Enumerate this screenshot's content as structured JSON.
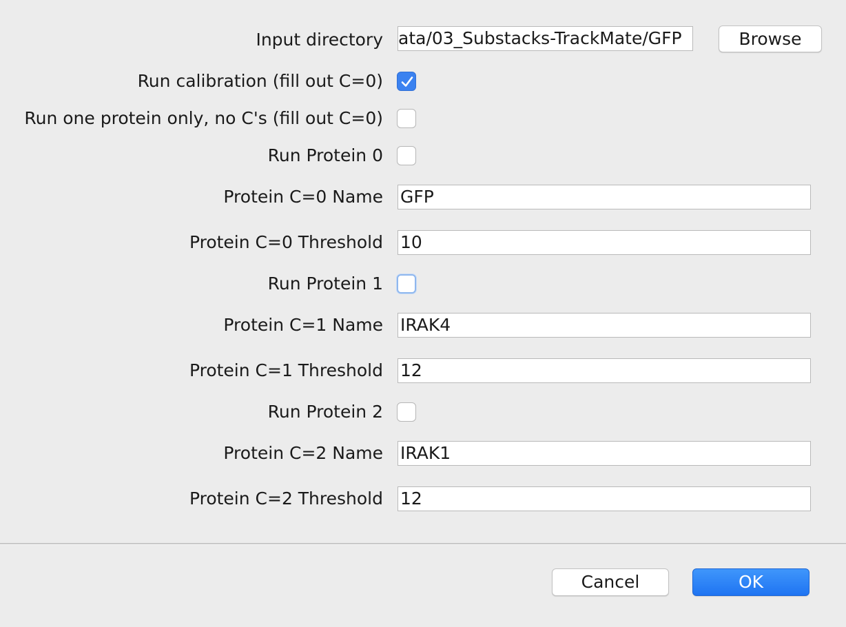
{
  "form": {
    "input_directory": {
      "label": "Input directory",
      "value": "ata/03_Substacks-TrackMate/GFP",
      "browse_label": "Browse"
    },
    "run_calibration": {
      "label": "Run calibration (fill out C=0)",
      "checked": true
    },
    "run_one_protein": {
      "label": "Run one protein only, no C's (fill out C=0)",
      "checked": false
    },
    "run_protein_0": {
      "label": "Run Protein 0",
      "checked": false
    },
    "protein_0_name": {
      "label": "Protein C=0 Name",
      "value": "GFP"
    },
    "protein_0_threshold": {
      "label": "Protein C=0 Threshold",
      "value": "10"
    },
    "run_protein_1": {
      "label": "Run Protein 1",
      "checked": false
    },
    "protein_1_name": {
      "label": "Protein C=1 Name",
      "value": "IRAK4"
    },
    "protein_1_threshold": {
      "label": "Protein C=1 Threshold",
      "value": "12"
    },
    "run_protein_2": {
      "label": "Run Protein 2",
      "checked": false
    },
    "protein_2_name": {
      "label": "Protein C=2 Name",
      "value": "IRAK1"
    },
    "protein_2_threshold": {
      "label": "Protein C=2 Threshold",
      "value": "12"
    }
  },
  "footer": {
    "cancel_label": "Cancel",
    "ok_label": "OK"
  },
  "colors": {
    "accent": "#3b82f0",
    "background": "#ececec"
  }
}
